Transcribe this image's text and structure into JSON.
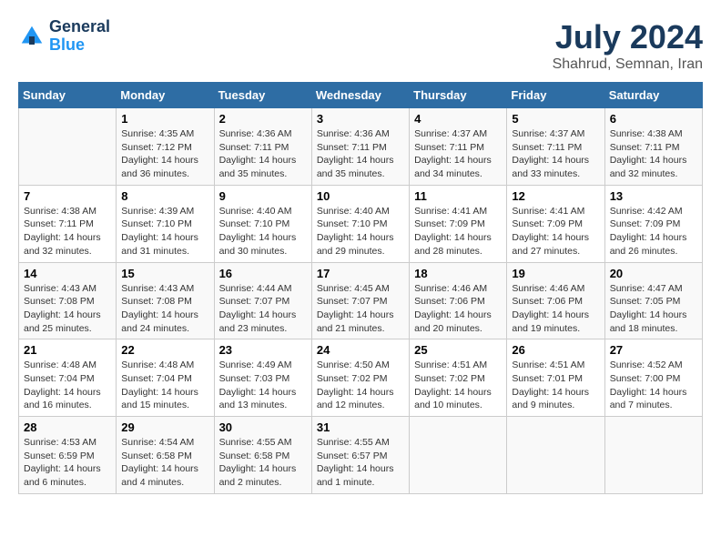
{
  "header": {
    "logo_line1": "General",
    "logo_line2": "Blue",
    "title": "July 2024",
    "subtitle": "Shahrud, Semnan, Iran"
  },
  "weekdays": [
    "Sunday",
    "Monday",
    "Tuesday",
    "Wednesday",
    "Thursday",
    "Friday",
    "Saturday"
  ],
  "weeks": [
    [
      {
        "day": null,
        "sunrise": null,
        "sunset": null,
        "daylight": null
      },
      {
        "day": "1",
        "sunrise": "Sunrise: 4:35 AM",
        "sunset": "Sunset: 7:12 PM",
        "daylight": "Daylight: 14 hours and 36 minutes."
      },
      {
        "day": "2",
        "sunrise": "Sunrise: 4:36 AM",
        "sunset": "Sunset: 7:11 PM",
        "daylight": "Daylight: 14 hours and 35 minutes."
      },
      {
        "day": "3",
        "sunrise": "Sunrise: 4:36 AM",
        "sunset": "Sunset: 7:11 PM",
        "daylight": "Daylight: 14 hours and 35 minutes."
      },
      {
        "day": "4",
        "sunrise": "Sunrise: 4:37 AM",
        "sunset": "Sunset: 7:11 PM",
        "daylight": "Daylight: 14 hours and 34 minutes."
      },
      {
        "day": "5",
        "sunrise": "Sunrise: 4:37 AM",
        "sunset": "Sunset: 7:11 PM",
        "daylight": "Daylight: 14 hours and 33 minutes."
      },
      {
        "day": "6",
        "sunrise": "Sunrise: 4:38 AM",
        "sunset": "Sunset: 7:11 PM",
        "daylight": "Daylight: 14 hours and 32 minutes."
      }
    ],
    [
      {
        "day": "7",
        "sunrise": "Sunrise: 4:38 AM",
        "sunset": "Sunset: 7:11 PM",
        "daylight": "Daylight: 14 hours and 32 minutes."
      },
      {
        "day": "8",
        "sunrise": "Sunrise: 4:39 AM",
        "sunset": "Sunset: 7:10 PM",
        "daylight": "Daylight: 14 hours and 31 minutes."
      },
      {
        "day": "9",
        "sunrise": "Sunrise: 4:40 AM",
        "sunset": "Sunset: 7:10 PM",
        "daylight": "Daylight: 14 hours and 30 minutes."
      },
      {
        "day": "10",
        "sunrise": "Sunrise: 4:40 AM",
        "sunset": "Sunset: 7:10 PM",
        "daylight": "Daylight: 14 hours and 29 minutes."
      },
      {
        "day": "11",
        "sunrise": "Sunrise: 4:41 AM",
        "sunset": "Sunset: 7:09 PM",
        "daylight": "Daylight: 14 hours and 28 minutes."
      },
      {
        "day": "12",
        "sunrise": "Sunrise: 4:41 AM",
        "sunset": "Sunset: 7:09 PM",
        "daylight": "Daylight: 14 hours and 27 minutes."
      },
      {
        "day": "13",
        "sunrise": "Sunrise: 4:42 AM",
        "sunset": "Sunset: 7:09 PM",
        "daylight": "Daylight: 14 hours and 26 minutes."
      }
    ],
    [
      {
        "day": "14",
        "sunrise": "Sunrise: 4:43 AM",
        "sunset": "Sunset: 7:08 PM",
        "daylight": "Daylight: 14 hours and 25 minutes."
      },
      {
        "day": "15",
        "sunrise": "Sunrise: 4:43 AM",
        "sunset": "Sunset: 7:08 PM",
        "daylight": "Daylight: 14 hours and 24 minutes."
      },
      {
        "day": "16",
        "sunrise": "Sunrise: 4:44 AM",
        "sunset": "Sunset: 7:07 PM",
        "daylight": "Daylight: 14 hours and 23 minutes."
      },
      {
        "day": "17",
        "sunrise": "Sunrise: 4:45 AM",
        "sunset": "Sunset: 7:07 PM",
        "daylight": "Daylight: 14 hours and 21 minutes."
      },
      {
        "day": "18",
        "sunrise": "Sunrise: 4:46 AM",
        "sunset": "Sunset: 7:06 PM",
        "daylight": "Daylight: 14 hours and 20 minutes."
      },
      {
        "day": "19",
        "sunrise": "Sunrise: 4:46 AM",
        "sunset": "Sunset: 7:06 PM",
        "daylight": "Daylight: 14 hours and 19 minutes."
      },
      {
        "day": "20",
        "sunrise": "Sunrise: 4:47 AM",
        "sunset": "Sunset: 7:05 PM",
        "daylight": "Daylight: 14 hours and 18 minutes."
      }
    ],
    [
      {
        "day": "21",
        "sunrise": "Sunrise: 4:48 AM",
        "sunset": "Sunset: 7:04 PM",
        "daylight": "Daylight: 14 hours and 16 minutes."
      },
      {
        "day": "22",
        "sunrise": "Sunrise: 4:48 AM",
        "sunset": "Sunset: 7:04 PM",
        "daylight": "Daylight: 14 hours and 15 minutes."
      },
      {
        "day": "23",
        "sunrise": "Sunrise: 4:49 AM",
        "sunset": "Sunset: 7:03 PM",
        "daylight": "Daylight: 14 hours and 13 minutes."
      },
      {
        "day": "24",
        "sunrise": "Sunrise: 4:50 AM",
        "sunset": "Sunset: 7:02 PM",
        "daylight": "Daylight: 14 hours and 12 minutes."
      },
      {
        "day": "25",
        "sunrise": "Sunrise: 4:51 AM",
        "sunset": "Sunset: 7:02 PM",
        "daylight": "Daylight: 14 hours and 10 minutes."
      },
      {
        "day": "26",
        "sunrise": "Sunrise: 4:51 AM",
        "sunset": "Sunset: 7:01 PM",
        "daylight": "Daylight: 14 hours and 9 minutes."
      },
      {
        "day": "27",
        "sunrise": "Sunrise: 4:52 AM",
        "sunset": "Sunset: 7:00 PM",
        "daylight": "Daylight: 14 hours and 7 minutes."
      }
    ],
    [
      {
        "day": "28",
        "sunrise": "Sunrise: 4:53 AM",
        "sunset": "Sunset: 6:59 PM",
        "daylight": "Daylight: 14 hours and 6 minutes."
      },
      {
        "day": "29",
        "sunrise": "Sunrise: 4:54 AM",
        "sunset": "Sunset: 6:58 PM",
        "daylight": "Daylight: 14 hours and 4 minutes."
      },
      {
        "day": "30",
        "sunrise": "Sunrise: 4:55 AM",
        "sunset": "Sunset: 6:58 PM",
        "daylight": "Daylight: 14 hours and 2 minutes."
      },
      {
        "day": "31",
        "sunrise": "Sunrise: 4:55 AM",
        "sunset": "Sunset: 6:57 PM",
        "daylight": "Daylight: 14 hours and 1 minute."
      },
      {
        "day": null,
        "sunrise": null,
        "sunset": null,
        "daylight": null
      },
      {
        "day": null,
        "sunrise": null,
        "sunset": null,
        "daylight": null
      },
      {
        "day": null,
        "sunrise": null,
        "sunset": null,
        "daylight": null
      }
    ]
  ]
}
